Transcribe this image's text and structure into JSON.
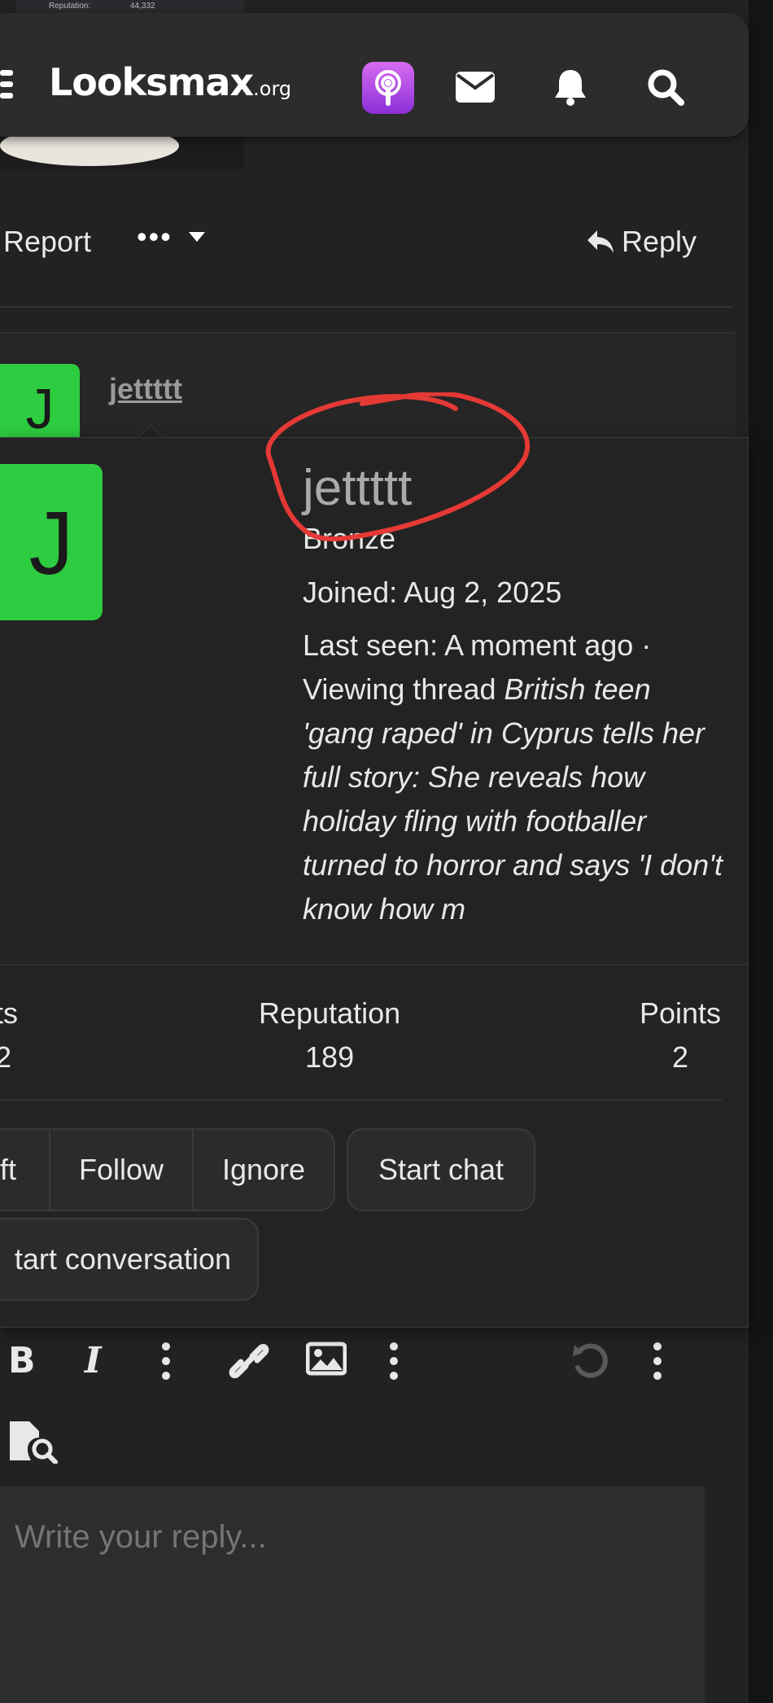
{
  "header": {
    "logo_main": "Looksmax",
    "logo_suffix": ".org",
    "icons": [
      "menu-icon",
      "podcast-icon",
      "mail-icon",
      "bell-icon",
      "search-icon"
    ]
  },
  "prev_post_image": {
    "text_left": "Reputation:",
    "text_right": "44,332"
  },
  "post_actions": {
    "report": "Report",
    "more": "•••",
    "reply": "Reply"
  },
  "next_post": {
    "avatar_letter": "J",
    "username": "jettttt"
  },
  "member_card": {
    "avatar_letter": "J",
    "avatar_color": "#2ecc40",
    "username": "jettttt",
    "user_title": "Bronze",
    "joined": "Joined: Aug 2, 2025",
    "last_seen_prefix": "Last seen: A moment ago · Viewing thread ",
    "last_seen_thread": "British teen 'gang raped' in Cyprus tells her full story: She reveals how holiday fling with footballer turned to horror and says 'I don't know how m",
    "stats": [
      {
        "label": "ts",
        "value": "2"
      },
      {
        "label": "Reputation",
        "value": "189"
      },
      {
        "label": "Points",
        "value": "2"
      }
    ],
    "buttons": {
      "gift": "ft",
      "follow": "Follow",
      "ignore": "Ignore",
      "start_chat": "Start chat",
      "start_conversation": "tart conversation"
    },
    "annotation_color": "#e53935"
  },
  "editor": {
    "placeholder": "Write your reply..."
  }
}
